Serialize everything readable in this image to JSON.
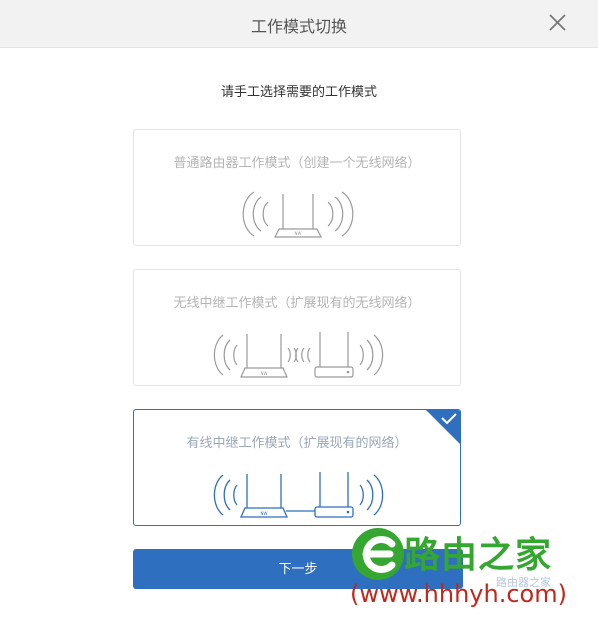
{
  "dialog": {
    "title": "工作模式切换",
    "subtitle": "请手工选择需要的工作模式",
    "next_label": "下一步"
  },
  "modes": [
    {
      "label": "普通路由器工作模式（创建一个无线网络）",
      "selected": false
    },
    {
      "label": "无线中继工作模式（扩展现有的无线网络）",
      "selected": false
    },
    {
      "label": "有线中继工作模式（扩展现有的网络）",
      "selected": true
    }
  ],
  "watermark": {
    "brand": "路由之家",
    "url": "(www.hhhyh.com)",
    "sub": "路由器之家"
  },
  "colors": {
    "accent": "#2f6fbf",
    "card_border": "#e3e3e3",
    "illustration_gray": "#9a9a9a",
    "watermark_green": "#35a62f",
    "watermark_red": "#c0281c"
  },
  "icons": {
    "close": "close-icon",
    "check": "checkmark-icon",
    "router": "router-icon",
    "repeater": "repeater-icon"
  }
}
